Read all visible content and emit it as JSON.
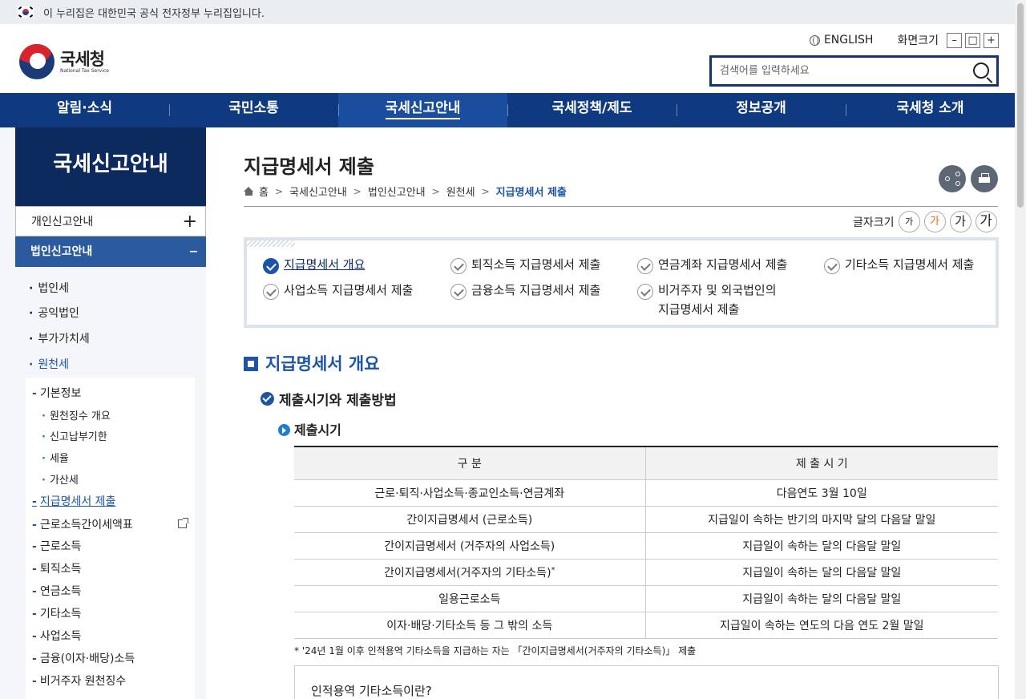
{
  "gov_banner": {
    "text": "이 누리집은 대한민국 공식 전자정부 누리집입니다."
  },
  "header": {
    "logo_ko": "국세청",
    "logo_en": "National Tax Service",
    "english": "ENGLISH",
    "zoom_label": "화면크기",
    "zoom_out": "–",
    "zoom_reset": "□",
    "zoom_in": "+",
    "search_placeholder": "검색어를 입력하세요"
  },
  "gnb": [
    {
      "label": "알림·소식"
    },
    {
      "label": "국민소통"
    },
    {
      "label": "국세신고안내"
    },
    {
      "label": "국세정책/제도"
    },
    {
      "label": "정보공개"
    },
    {
      "label": "국세청 소개"
    }
  ],
  "lnb": {
    "title": "국세신고안내",
    "d1_personal": "개인신고안내",
    "d1_corp": "법인신고안내",
    "toggle_plus": "+",
    "toggle_minus": "–",
    "d2": [
      "법인세",
      "공익법인",
      "부가가치세",
      "원천세"
    ],
    "d3_basic": "기본정보",
    "d4": [
      "원천징수 개요",
      "신고납부기한",
      "세율",
      "가산세"
    ],
    "d3": [
      "지급명세서 제출",
      "근로소득간이세액표",
      "근로소득",
      "퇴직소득",
      "연금소득",
      "기타소득",
      "사업소득",
      "금융(이자·배당)소득",
      "비거주자 원천징수"
    ]
  },
  "content": {
    "title": "지급명세서 제출",
    "breadcrumb": [
      "홈",
      "국세신고안내",
      "법인신고안내",
      "원천세",
      "지급명세서 제출"
    ],
    "font_label": "글자크기",
    "font_btn": "가",
    "tabs": [
      "지급명세서 개요",
      "퇴직소득 지급명세서 제출",
      "연금계좌 지급명세서 제출",
      "기타소득 지급명세서 제출",
      "사업소득 지급명세서 제출",
      "금융소득 지급명세서 제출",
      "비거주자 및 외국법인의",
      "지급명세서 제출"
    ],
    "h3": "지급명세서 개요",
    "h4": "제출시기와 제출방법",
    "h5": "제출시기",
    "table": {
      "headers": [
        "구 분",
        "제 출 시 기"
      ],
      "rows": [
        [
          "근로·퇴직·사업소득·종교인소득·연금계좌",
          "다음연도 3월 10일"
        ],
        [
          "간이지급명세서 (근로소득)",
          "지급일이 속하는 반기의 마지막 달의 다음달 말일"
        ],
        [
          "간이지급명세서 (거주자의 사업소득)",
          "지급일이 속하는 달의 다음달 말일"
        ],
        [
          "간이지급명세서(거주자의 기타소득)",
          "지급일이 속하는 달의 다음달 말일"
        ],
        [
          "일용근로소득",
          "지급일이 속하는 달의 다음달 말일"
        ],
        [
          "이자·배당·기타소득 등 그 밖의 소득",
          "지급일이 속하는 연도의 다음 연도 2월 말일"
        ]
      ],
      "sup": "*"
    },
    "note": "* '24년 1월 이후 인적용역 기타소득을 지급하는 자는 「간이지급명세서(거주자의 기타소득)」 제출",
    "info_title": "인적용역 기타소득이란?"
  },
  "colors": {
    "brand_navy": "#0f3a80",
    "accent_blue": "#1d54a8",
    "sidebar_title": "#0c2a5e"
  }
}
